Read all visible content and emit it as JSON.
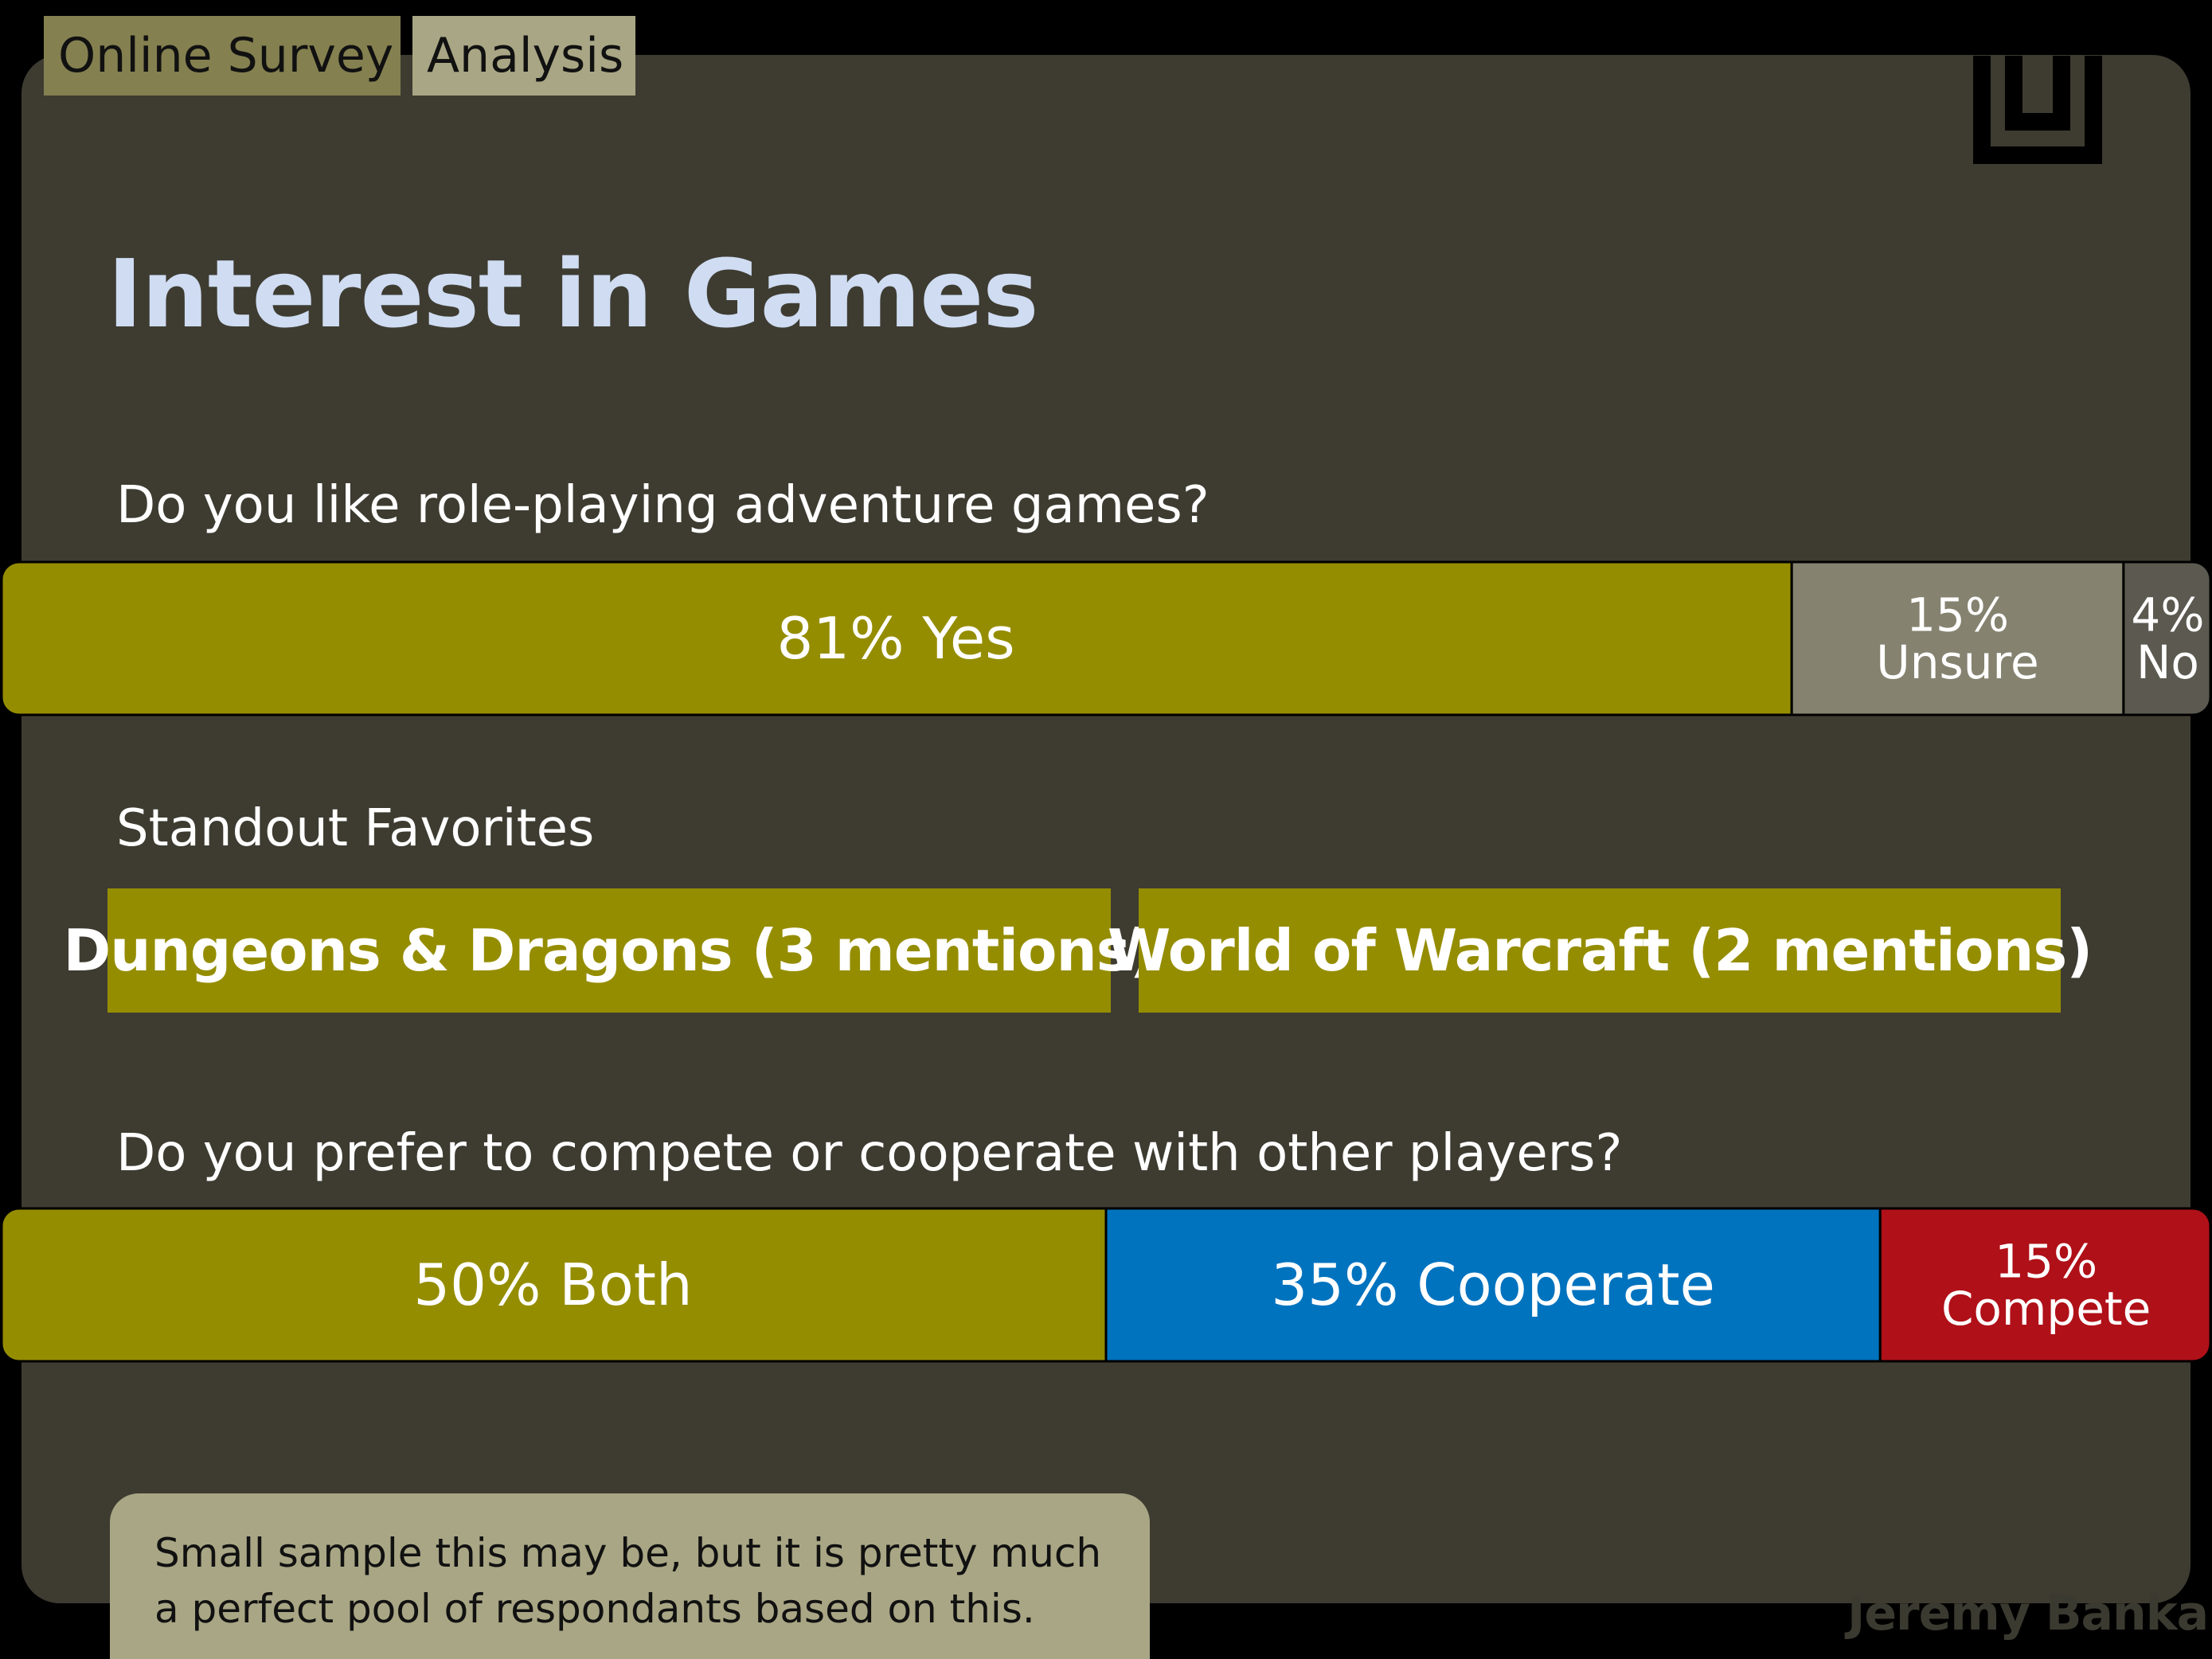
{
  "header": {
    "tabs": [
      {
        "label": "Online Survey"
      },
      {
        "label": "Analysis"
      }
    ]
  },
  "title": "Interest in Games",
  "questions": {
    "q1": "Do you like role-playing adventure games?",
    "favorites_heading": "Standout Favorites",
    "q2": "Do you prefer to compete or cooperate with other players?"
  },
  "favorites": [
    "Dungeons & Dragons (3  mentions)",
    "World of Warcraft (2  mentions)"
  ],
  "note": "Small sample this may be, but it is pretty much a perfect pool of respondants based on this.",
  "credit": "Jeremy Banka",
  "colors": {
    "olive": "#958d00",
    "gray": "#858270",
    "dark_gray": "#5c5a50",
    "blue": "#0073bf",
    "red": "#b01018"
  },
  "chart_data": [
    {
      "type": "bar",
      "stacked": true,
      "orientation": "horizontal",
      "title": "Do you like role-playing adventure games?",
      "unit": "%",
      "series": [
        {
          "name": "Yes",
          "value": 81,
          "labels": [
            "81% Yes"
          ],
          "color": "#958d00"
        },
        {
          "name": "Unsure",
          "value": 15,
          "labels": [
            "15%",
            "Unsure"
          ],
          "color": "#858270"
        },
        {
          "name": "No",
          "value": 4,
          "labels": [
            "4%",
            "No"
          ],
          "color": "#5c5a50"
        }
      ]
    },
    {
      "type": "bar",
      "stacked": true,
      "orientation": "horizontal",
      "title": "Do you prefer to compete or cooperate with other players?",
      "unit": "%",
      "series": [
        {
          "name": "Both",
          "value": 50,
          "labels": [
            "50% Both"
          ],
          "color": "#958d00"
        },
        {
          "name": "Cooperate",
          "value": 35,
          "labels": [
            "35% Cooperate"
          ],
          "color": "#0073bf"
        },
        {
          "name": "Compete",
          "value": 15,
          "labels": [
            "15%",
            "Compete"
          ],
          "color": "#b01018"
        }
      ]
    }
  ]
}
